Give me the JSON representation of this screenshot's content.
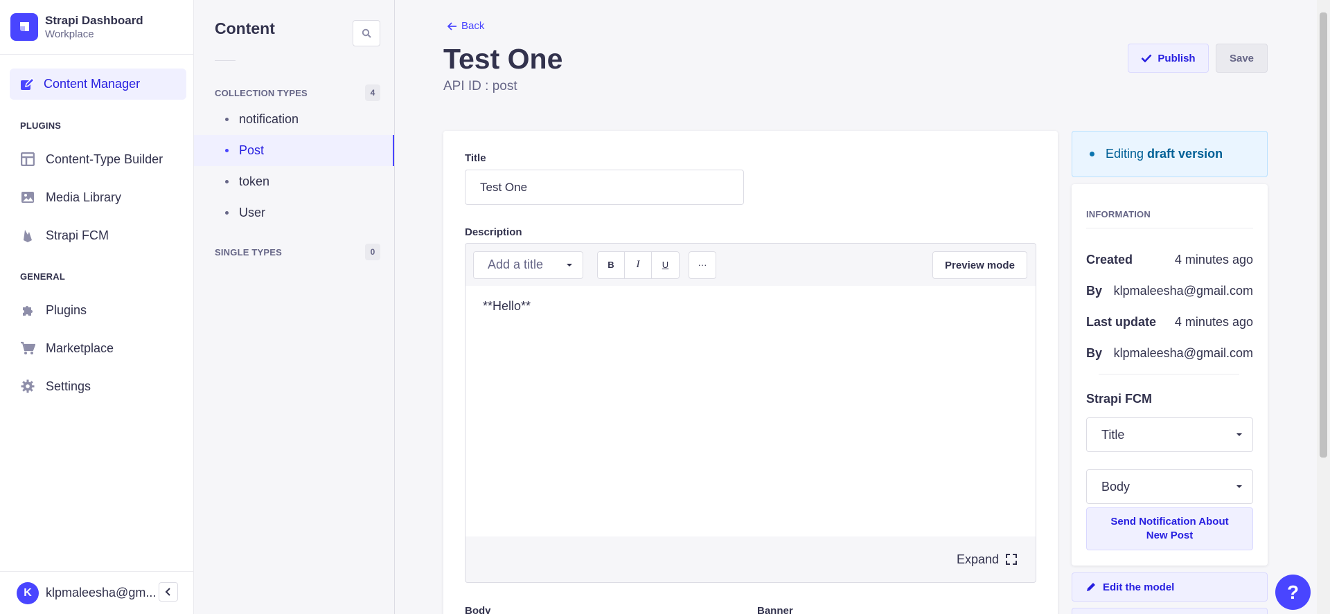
{
  "brand": {
    "title": "Strapi Dashboard",
    "subtitle": "Workplace"
  },
  "mainnav": {
    "active": {
      "label": "Content Manager",
      "icon": "pencil-square-icon"
    },
    "plugins_heading": "PLUGINS",
    "plugins": [
      {
        "label": "Content-Type Builder",
        "icon": "layout-icon"
      },
      {
        "label": "Media Library",
        "icon": "image-icon"
      },
      {
        "label": "Strapi FCM",
        "icon": "firebase-icon"
      }
    ],
    "general_heading": "GENERAL",
    "general": [
      {
        "label": "Plugins",
        "icon": "puzzle-icon"
      },
      {
        "label": "Marketplace",
        "icon": "cart-icon"
      },
      {
        "label": "Settings",
        "icon": "gear-icon"
      }
    ],
    "profile": {
      "initial": "K",
      "name": "klpmaleesha@gm..."
    }
  },
  "subnav": {
    "title": "Content",
    "collection_types_label": "COLLECTION TYPES",
    "collection_types_count": "4",
    "collection_types": [
      "notification",
      "Post",
      "token",
      "User"
    ],
    "active_index": 1,
    "single_types_label": "SINGLE TYPES",
    "single_types_count": "0"
  },
  "header": {
    "back_label": "Back",
    "title": "Test One",
    "api_id": "API ID : post",
    "publish_label": "Publish",
    "save_label": "Save"
  },
  "form": {
    "title_label": "Title",
    "title_value": "Test One",
    "description_label": "Description",
    "heading_select": "Add a title",
    "bold_label": "B",
    "italic_label": "I",
    "underline_label": "U",
    "more_label": "···",
    "preview_label": "Preview mode",
    "body_text": "**Hello**",
    "expand_label": "Expand",
    "body_label": "Body",
    "banner_label": "Banner"
  },
  "sidepanel": {
    "draft_prefix": "Editing",
    "draft_strong": "draft version",
    "info_heading": "INFORMATION",
    "created_label": "Created",
    "created_value": "4 minutes ago",
    "by1_label": "By",
    "by1_value": "klpmaleesha@gmail.com",
    "updated_label": "Last update",
    "updated_value": "4 minutes ago",
    "by2_label": "By",
    "by2_value": "klpmaleesha@gmail.com",
    "fcm_title": "Strapi FCM",
    "fcm_title_select": "Title",
    "fcm_body_select": "Body",
    "fcm_send_label": "Send Notification About New Post",
    "edit_model_label": "Edit the model"
  },
  "help": {
    "label": "?"
  },
  "colors": {
    "primary": "#4945ff",
    "primary_light": "#f0f0ff",
    "text": "#32324d",
    "muted": "#666687",
    "info_bg": "#eaf5ff"
  }
}
